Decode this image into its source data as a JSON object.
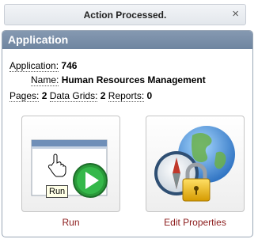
{
  "notification": {
    "message": "Action Processed.",
    "close_glyph": "×"
  },
  "panel": {
    "title": "Application",
    "application_label": "Application:",
    "application_value": "746",
    "name_label": "Name:",
    "name_value": "Human Resources Management",
    "pages_label": "Pages:",
    "pages_value": "2",
    "grids_label": "Data Grids:",
    "grids_value": "2",
    "reports_label": "Reports:",
    "reports_value": "0"
  },
  "actions": [
    {
      "label": "Run",
      "tooltip": "Run",
      "icon": "run-icon"
    },
    {
      "label": "Edit Properties",
      "icon": "edit-properties-icon"
    }
  ],
  "colors": {
    "header": "#7a8fa9",
    "action_link": "#8b1a1a",
    "run_green": "#2a9a3a"
  }
}
